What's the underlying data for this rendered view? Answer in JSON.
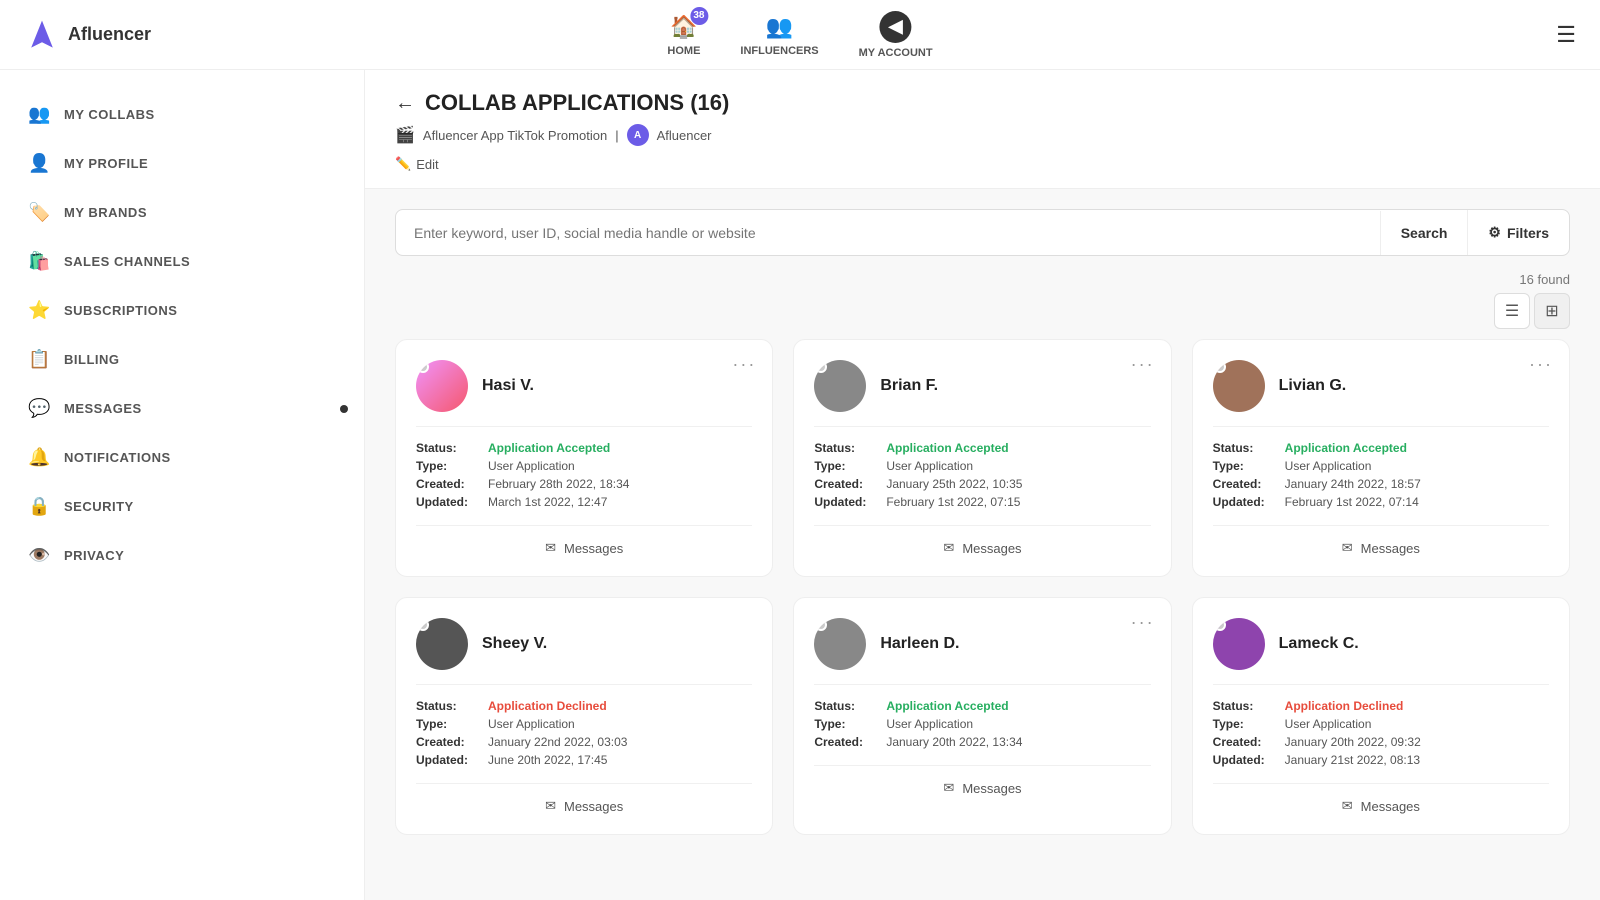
{
  "app": {
    "name": "Afluencer"
  },
  "topnav": {
    "badge_count": "38",
    "home_label": "HOME",
    "influencers_label": "INFLUENCERS",
    "my_account_label": "MY ACCOUNT"
  },
  "sidebar": {
    "items": [
      {
        "id": "my-collabs",
        "label": "MY COLLABS",
        "icon": "👥"
      },
      {
        "id": "my-profile",
        "label": "MY PROFILE",
        "icon": "👤"
      },
      {
        "id": "my-brands",
        "label": "MY BRANDS",
        "icon": "🏷️"
      },
      {
        "id": "sales-channels",
        "label": "SALES CHANNELS",
        "icon": "🛍️"
      },
      {
        "id": "subscriptions",
        "label": "SUBSCRIPTIONS",
        "icon": "⭐"
      },
      {
        "id": "billing",
        "label": "BILLING",
        "icon": "📋"
      },
      {
        "id": "messages",
        "label": "MESSAGES",
        "icon": "💬",
        "has_dot": true
      },
      {
        "id": "notifications",
        "label": "NOTIFICATIONS",
        "icon": "🔔"
      },
      {
        "id": "security",
        "label": "SECURITY",
        "icon": "🔒"
      },
      {
        "id": "privacy",
        "label": "PRIVACY",
        "icon": "👁️"
      }
    ]
  },
  "header": {
    "title": "COLLAB APPLICATIONS (16)",
    "collab_name": "Afluencer App TikTok Promotion",
    "brand_name": "Afluencer",
    "edit_label": "Edit"
  },
  "search": {
    "placeholder": "Enter keyword, user ID, social media handle or website",
    "search_label": "Search",
    "filters_label": "Filters",
    "found_text": "16 found"
  },
  "view_toggle": {
    "list_icon": "≡",
    "grid_icon": "⊞"
  },
  "cards": [
    {
      "id": 1,
      "name": "Hasi V.",
      "avatar_color": "av-pink",
      "status": "Application Accepted",
      "status_type": "accepted",
      "type": "User Application",
      "created": "February 28th 2022, 18:34",
      "updated": "March 1st 2022, 12:47",
      "messages_label": "Messages"
    },
    {
      "id": 2,
      "name": "Brian F.",
      "avatar_color": "av-gray",
      "status": "Application Accepted",
      "status_type": "accepted",
      "type": "User Application",
      "created": "January 25th 2022, 10:35",
      "updated": "February 1st 2022, 07:15",
      "messages_label": "Messages"
    },
    {
      "id": 3,
      "name": "Livian G.",
      "avatar_color": "av-brown",
      "status": "Application Accepted",
      "status_type": "accepted",
      "type": "User Application",
      "created": "January 24th 2022, 18:57",
      "updated": "February 1st 2022, 07:14",
      "messages_label": "Messages"
    },
    {
      "id": 4,
      "name": "Sheey V.",
      "avatar_color": "av-robot",
      "status": "Application Declined",
      "status_type": "declined",
      "type": "User Application",
      "created": "January 22nd 2022, 03:03",
      "updated": "June 20th 2022, 17:45",
      "messages_label": "Messages"
    },
    {
      "id": 5,
      "name": "Harleen D.",
      "avatar_color": "av-gray",
      "status": "Application Accepted",
      "status_type": "accepted",
      "type": "User Application",
      "created": "January 20th 2022, 13:34",
      "updated": "",
      "messages_label": "Messages"
    },
    {
      "id": 6,
      "name": "Lameck C.",
      "avatar_color": "av-purple",
      "status": "Application Declined",
      "status_type": "declined",
      "type": "User Application",
      "created": "January 20th 2022, 09:32",
      "updated": "January 21st 2022, 08:13",
      "messages_label": "Messages"
    }
  ],
  "labels": {
    "status": "Status:",
    "type": "Type:",
    "created": "Created:",
    "updated": "Updated:"
  }
}
